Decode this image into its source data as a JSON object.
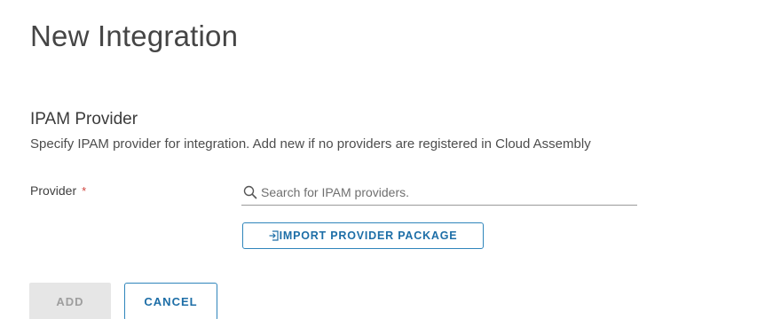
{
  "page": {
    "title": "New Integration"
  },
  "section": {
    "title": "IPAM Provider",
    "description": "Specify IPAM provider for integration. Add new if no providers are registered in Cloud Assembly"
  },
  "provider_field": {
    "label": "Provider",
    "required_marker": "*",
    "search_icon": "search-icon",
    "placeholder": "Search for IPAM providers.",
    "value": ""
  },
  "import_button": {
    "icon": "import-icon",
    "label": "IMPORT PROVIDER PACKAGE"
  },
  "actions": {
    "add_label": "ADD",
    "add_enabled": false,
    "cancel_label": "CANCEL"
  },
  "colors": {
    "accent": "#1d6ea7",
    "accent_border": "#2f85bb",
    "required": "#d0443e",
    "disabled_bg": "#e6e6e6",
    "disabled_text": "#9e9e9e"
  }
}
